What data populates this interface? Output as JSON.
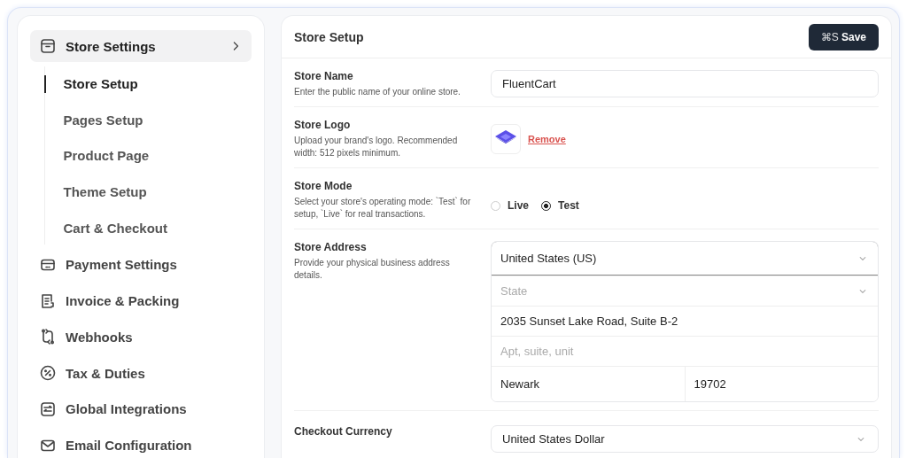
{
  "sidebar": {
    "items": [
      {
        "label": "Store Settings",
        "selected": true,
        "children": [
          {
            "label": "Store Setup",
            "selected": true
          },
          {
            "label": "Pages Setup",
            "selected": false
          },
          {
            "label": "Product Page",
            "selected": false
          },
          {
            "label": "Theme Setup",
            "selected": false
          },
          {
            "label": "Cart & Checkout",
            "selected": false
          }
        ]
      },
      {
        "label": "Payment Settings",
        "selected": false
      },
      {
        "label": "Invoice & Packing",
        "selected": false
      },
      {
        "label": "Webhooks",
        "selected": false
      },
      {
        "label": "Tax & Duties",
        "selected": false
      },
      {
        "label": "Global Integrations",
        "selected": false
      },
      {
        "label": "Email Configuration",
        "selected": false
      }
    ]
  },
  "panel": {
    "title": "Store Setup",
    "save_button": {
      "shortcut": "⌘S",
      "label": "Save"
    }
  },
  "fields": [
    {
      "kind": "text",
      "label": "Store Name",
      "help": "Enter the public name of your online store.",
      "value": "FluentCart"
    },
    {
      "kind": "logo",
      "label": "Store Logo",
      "help": "Upload your brand's logo. Recommended width: 512 pixels minimum.",
      "link": "Remove"
    },
    {
      "kind": "radio",
      "label": "Store Mode",
      "help": "Select your store's operating mode: `Test` for setup, `Live` for real transactions.",
      "options": [
        {
          "label": "Live",
          "selected": false
        },
        {
          "label": "Test",
          "selected": true
        }
      ]
    },
    {
      "kind": "address",
      "label": "Store Address",
      "help": "Provide your physical business address details.",
      "country": "United States (US)",
      "state_placeholder": "State",
      "address_1": "2035 Sunset Lake Road, Suite B-2",
      "address_2_placeholder": "Apt, suite, unit",
      "city": "Newark",
      "zip": "19702"
    },
    {
      "kind": "select",
      "label": "Checkout Currency",
      "value": "United States Dollar"
    }
  ]
}
